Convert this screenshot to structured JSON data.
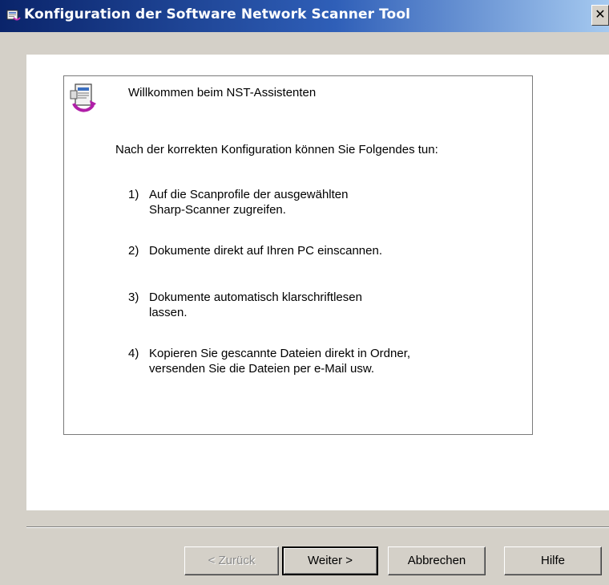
{
  "window": {
    "title": "Konfiguration der Software Network Scanner Tool",
    "close_glyph": "✕"
  },
  "wizard": {
    "welcome": "Willkommen beim NST-Assistenten",
    "intro": "Nach der korrekten Konfiguration können Sie Folgendes tun:",
    "items": [
      {
        "num": "1)",
        "text": "Auf die Scanprofile der ausgewählten\nSharp-Scanner zugreifen."
      },
      {
        "num": "2)",
        "text": "Dokumente direkt auf Ihren PC einscannen."
      },
      {
        "num": "3)",
        "text": "Dokumente automatisch klarschriftlesen\nlassen."
      },
      {
        "num": "4)",
        "text": "Kopieren Sie gescannte Dateien direkt in Ordner,\nversenden Sie die Dateien per e-Mail usw."
      }
    ]
  },
  "buttons": {
    "back": "< Zurück",
    "next": "Weiter >",
    "cancel": "Abbrechen",
    "help": "Hilfe"
  },
  "icons": {
    "title": "scanner-app-icon",
    "wizard": "document-arrow-icon"
  }
}
